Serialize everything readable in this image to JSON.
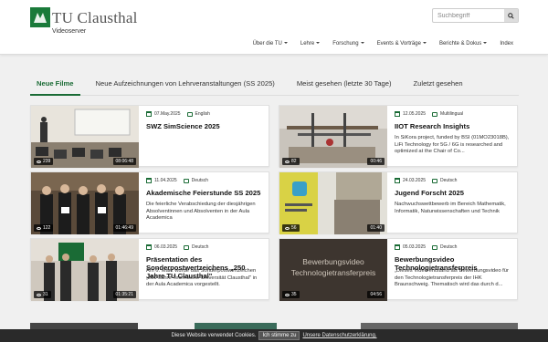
{
  "header": {
    "logo_text": "TU Clausthal",
    "subtitle": "Videoserver",
    "search_placeholder": "Suchbegriff",
    "nav": [
      {
        "label": "Über die TU",
        "dropdown": true
      },
      {
        "label": "Lehre",
        "dropdown": true
      },
      {
        "label": "Forschung",
        "dropdown": true
      },
      {
        "label": "Events & Vorträge",
        "dropdown": true
      },
      {
        "label": "Berichte & Dokus",
        "dropdown": true
      },
      {
        "label": "Index",
        "dropdown": false
      }
    ]
  },
  "tabs": [
    {
      "label": "Neue Filme",
      "active": true
    },
    {
      "label": "Neue Aufzeichnungen von Lehrveranstaltungen (SS 2025)"
    },
    {
      "label": "Meist gesehen (letzte 30 Tage)"
    },
    {
      "label": "Zuletzt gesehen"
    }
  ],
  "videos": [
    {
      "date": "07.May.2025",
      "lang": "English",
      "title": "SWZ SimScience 2025",
      "desc": "",
      "views": "239",
      "duration": "08:06:48",
      "thumb": "lecture"
    },
    {
      "date": "12.05.2025",
      "lang": "Multilingual",
      "title": "IIOT Research Insights",
      "desc": "In SiKora project, funded by BSI (01MO23018B), LiFi Technology for 5G / 6G is researched and optimized at the Chair of Co...",
      "views": "82",
      "duration": "00:46",
      "thumb": "lab"
    },
    {
      "date": "11.04.2025",
      "lang": "Deutsch",
      "title": "Akademische Feierstunde SS 2025",
      "desc": "Die feierliche Verabschiedung der diesjährigen Absolventinnen und Absolventen in der Aula Academica",
      "views": "122",
      "duration": "01:46:49",
      "thumb": "ceremony"
    },
    {
      "date": "24.03.2025",
      "lang": "Deutsch",
      "title": "Jugend Forscht 2025",
      "desc": "Nachwuchswettbewerb im Bereich Mathematik, Informatik, Naturwissenschaften und Technik",
      "views": "56",
      "duration": "01:40",
      "thumb": "poster"
    },
    {
      "date": "06.03.2025",
      "lang": "Deutsch",
      "title": "Präsentation des Sonderpostwertzeichens „250 Jahre TU Clausthal\"",
      "desc": "Am 6. März wurde das Sonderpostwertzeichen „250 Jahre Technische Universität Clausthal\" in der Aula Academica vorgestellt.",
      "views": "31",
      "duration": "01:35:21",
      "thumb": "stamp"
    },
    {
      "date": "05.03.2025",
      "lang": "Deutsch",
      "title": "Bewerbungsvideo Technologietransferpreis",
      "desc": "„Dieses Video entstand als Bewerbungsvideo für den Technologietransferpreis der IHK Braunschweig. Thematisch wird das durch d...",
      "views": "35",
      "duration": "04:56",
      "thumb": "dark",
      "thumb_text": "Bewerbungsvideo\nTechnologietransferpreis"
    }
  ],
  "cookie": {
    "text": "Diese Website verwendet Cookies.",
    "button": "Ich stimme zu",
    "link": "Unsere Datenschutzerklärung."
  },
  "colors": {
    "brand": "#1a6b35"
  }
}
